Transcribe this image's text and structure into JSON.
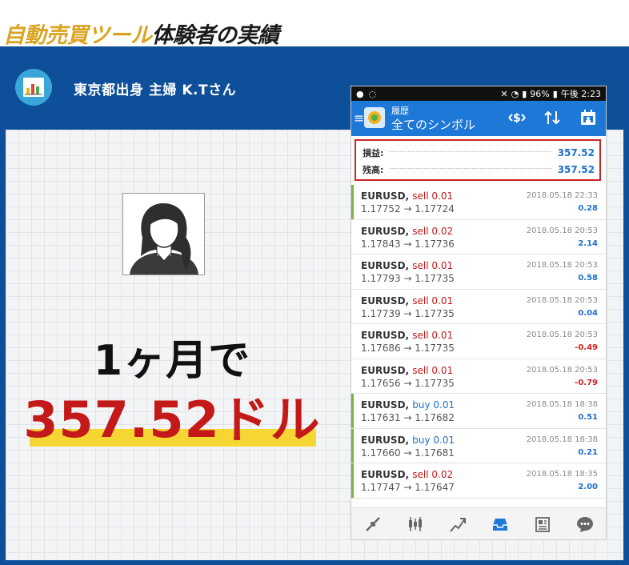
{
  "headline": {
    "gold": "自動売買ツール",
    "dark": "体験者の実績"
  },
  "profile": {
    "name": "東京都出身 主婦 K.Tさん"
  },
  "result": {
    "line1": "1ヶ月で",
    "line2": "357.52ドル"
  },
  "phone": {
    "status": {
      "battery": "96%",
      "time": "午後 2:23"
    },
    "appbar": {
      "subtitle": "履歴",
      "title": "全てのシンボル"
    },
    "summary": {
      "profit_label": "損益:",
      "profit_value": "357.52",
      "balance_label": "残高:",
      "balance_value": "357.52"
    },
    "trades": [
      {
        "pair": "EURUSD,",
        "side": "sell 0.01",
        "prices": "1.17752 → 1.17724",
        "time": "2018.05.18 22:33",
        "profit": "0.28"
      },
      {
        "pair": "EURUSD,",
        "side": "sell 0.02",
        "prices": "1.17843 → 1.17736",
        "time": "2018.05.18 20:53",
        "profit": "2.14"
      },
      {
        "pair": "EURUSD,",
        "side": "sell 0.01",
        "prices": "1.17793 → 1.17735",
        "time": "2018.05.18 20:53",
        "profit": "0.58"
      },
      {
        "pair": "EURUSD,",
        "side": "sell 0.01",
        "prices": "1.17739 → 1.17735",
        "time": "2018.05.18 20:53",
        "profit": "0.04"
      },
      {
        "pair": "EURUSD,",
        "side": "sell 0.01",
        "prices": "1.17686 → 1.17735",
        "time": "2018.05.18 20:53",
        "profit": "-0.49"
      },
      {
        "pair": "EURUSD,",
        "side": "sell 0.01",
        "prices": "1.17656 → 1.17735",
        "time": "2018.05.18 20:53",
        "profit": "-0.79"
      },
      {
        "pair": "EURUSD,",
        "side": "buy 0.01",
        "prices": "1.17631 → 1.17682",
        "time": "2018.05.18 18:38",
        "profit": "0.51"
      },
      {
        "pair": "EURUSD,",
        "side": "buy 0.01",
        "prices": "1.17660 → 1.17681",
        "time": "2018.05.18 18:38",
        "profit": "0.21"
      },
      {
        "pair": "EURUSD,",
        "side": "sell 0.02",
        "prices": "1.17747 → 1.17647",
        "time": "2018.05.18 18:35",
        "profit": "2.00"
      }
    ],
    "nav_icons": [
      "quotes-icon",
      "chart-icon",
      "trade-icon",
      "history-icon",
      "news-icon",
      "chat-icon"
    ]
  },
  "colors": {
    "panel_blue": "#0e4f99",
    "app_blue": "#1e78d8",
    "sell_red": "#c41919",
    "buy_blue": "#1e6fcf",
    "profit_blue": "#1e6fcf",
    "loss_red": "#d42020",
    "highlight_yellow": "#f6d633",
    "headline_gold": "#d9a421",
    "positive_bar": "#7cb342"
  }
}
